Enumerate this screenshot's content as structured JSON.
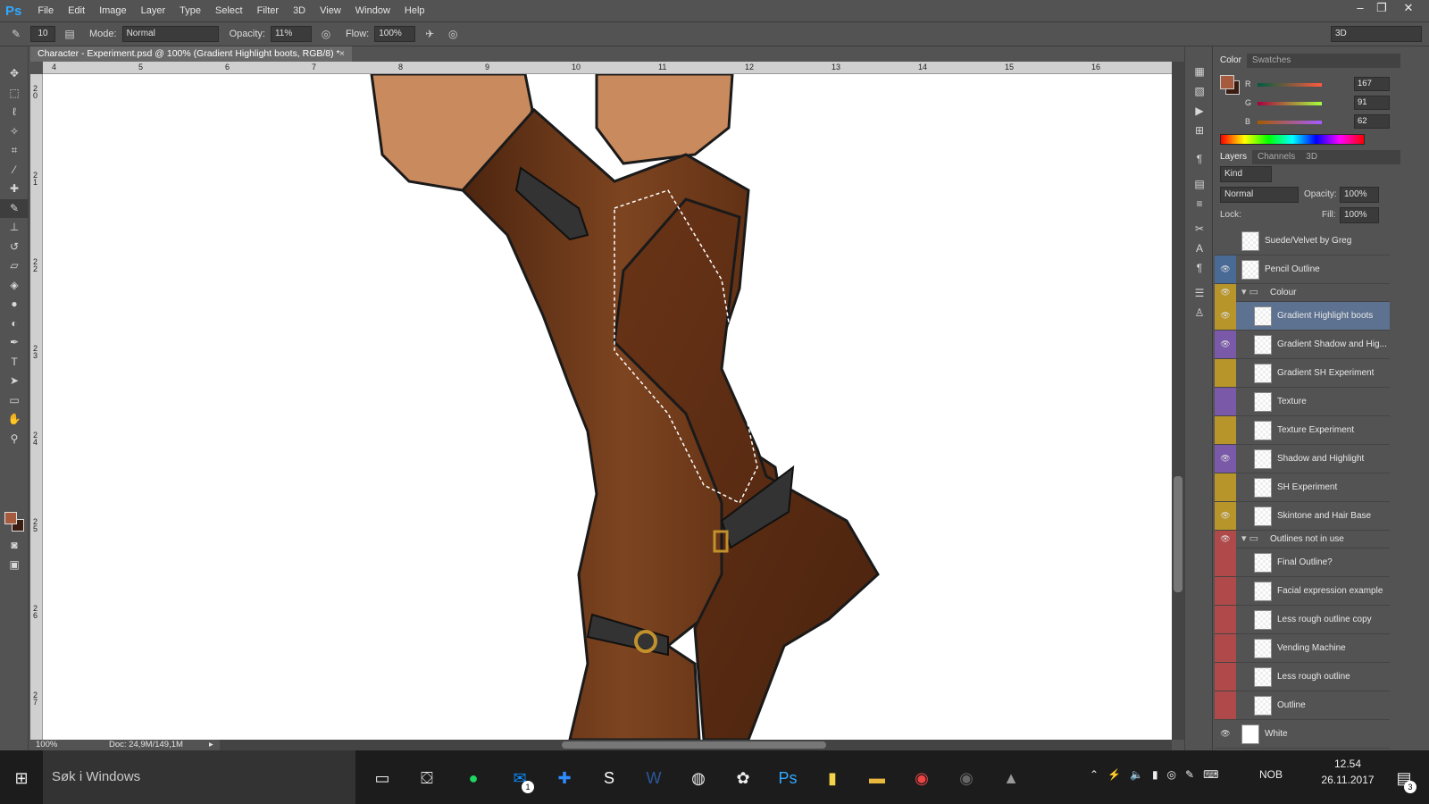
{
  "menubar": {
    "logo": "Ps",
    "items": [
      "File",
      "Edit",
      "Image",
      "Layer",
      "Type",
      "Select",
      "Filter",
      "3D",
      "View",
      "Window",
      "Help"
    ]
  },
  "options": {
    "brush_size": "10",
    "mode_label": "Mode:",
    "mode_value": "Normal",
    "opacity_label": "Opacity:",
    "opacity_value": "11%",
    "flow_label": "Flow:",
    "flow_value": "100%",
    "workspace": "3D"
  },
  "document": {
    "tab_title": "Character - Experiment.psd @ 100% (Gradient Highlight boots, RGB/8) *",
    "zoom": "100%",
    "doc_size": "Doc: 24,9M/149,1M"
  },
  "rulers": {
    "h_ticks": [
      "4",
      "5",
      "6",
      "7",
      "8",
      "9",
      "10",
      "11",
      "12",
      "13",
      "14",
      "15",
      "16"
    ],
    "v_ticks": [
      "20",
      "21",
      "22",
      "23",
      "24",
      "25",
      "26",
      "27"
    ]
  },
  "color_panel": {
    "tabs": [
      "Color",
      "Swatches"
    ],
    "fg_color": "#a75b3e",
    "bg_color": "#3a1d10",
    "r_label": "R",
    "g_label": "G",
    "b_label": "B",
    "r": "167",
    "g": "91",
    "b": "62"
  },
  "layers_panel": {
    "tabs": [
      "Layers",
      "Channels",
      "3D"
    ],
    "kind": "Kind",
    "blend": "Normal",
    "opacity_label": "Opacity:",
    "opacity": "100%",
    "lock_label": "Lock:",
    "fill_label": "Fill:",
    "fill": "100%",
    "layers": [
      {
        "name": "Suede/Velvet by Greg",
        "visible": false,
        "color": "",
        "indent": 0
      },
      {
        "name": "Pencil Outline",
        "visible": true,
        "color": "#4a6a96",
        "indent": 0
      },
      {
        "name": "Colour",
        "visible": true,
        "color": "#b8952b",
        "indent": 0,
        "group": true
      },
      {
        "name": "Gradient Highlight boots",
        "visible": true,
        "color": "#b8952b",
        "indent": 1,
        "selected": true
      },
      {
        "name": "Gradient Shadow and Hig...",
        "visible": true,
        "color": "#7a5aa8",
        "indent": 1
      },
      {
        "name": "Gradient SH Experiment",
        "visible": false,
        "color": "#b8952b",
        "indent": 1
      },
      {
        "name": "Texture",
        "visible": false,
        "color": "#7a5aa8",
        "indent": 1
      },
      {
        "name": "Texture Experiment",
        "visible": false,
        "color": "#b8952b",
        "indent": 1
      },
      {
        "name": "Shadow and Highlight",
        "visible": true,
        "color": "#7a5aa8",
        "indent": 1
      },
      {
        "name": "SH Experiment",
        "visible": false,
        "color": "#b8952b",
        "indent": 1
      },
      {
        "name": "Skintone and Hair Base",
        "visible": true,
        "color": "#b8952b",
        "indent": 1
      },
      {
        "name": "Outlines not in use",
        "visible": true,
        "color": "#b04a4a",
        "indent": 0,
        "group": true
      },
      {
        "name": "Final Outline?",
        "visible": false,
        "color": "#b04a4a",
        "indent": 1
      },
      {
        "name": "Facial expression example",
        "visible": false,
        "color": "#b04a4a",
        "indent": 1
      },
      {
        "name": "Less rough outline copy",
        "visible": false,
        "color": "#b04a4a",
        "indent": 1
      },
      {
        "name": "Vending Machine",
        "visible": false,
        "color": "#b04a4a",
        "indent": 1
      },
      {
        "name": "Less rough outline",
        "visible": false,
        "color": "#b04a4a",
        "indent": 1
      },
      {
        "name": "Outline",
        "visible": false,
        "color": "#b04a4a",
        "indent": 1
      },
      {
        "name": "White",
        "visible": true,
        "color": "",
        "indent": 0
      }
    ]
  },
  "taskbar": {
    "search": "Søk i Windows",
    "lang": "NOB",
    "time": "12.54",
    "date": "26.11.2017",
    "messenger_badge": "1",
    "notif_badge": "3"
  }
}
